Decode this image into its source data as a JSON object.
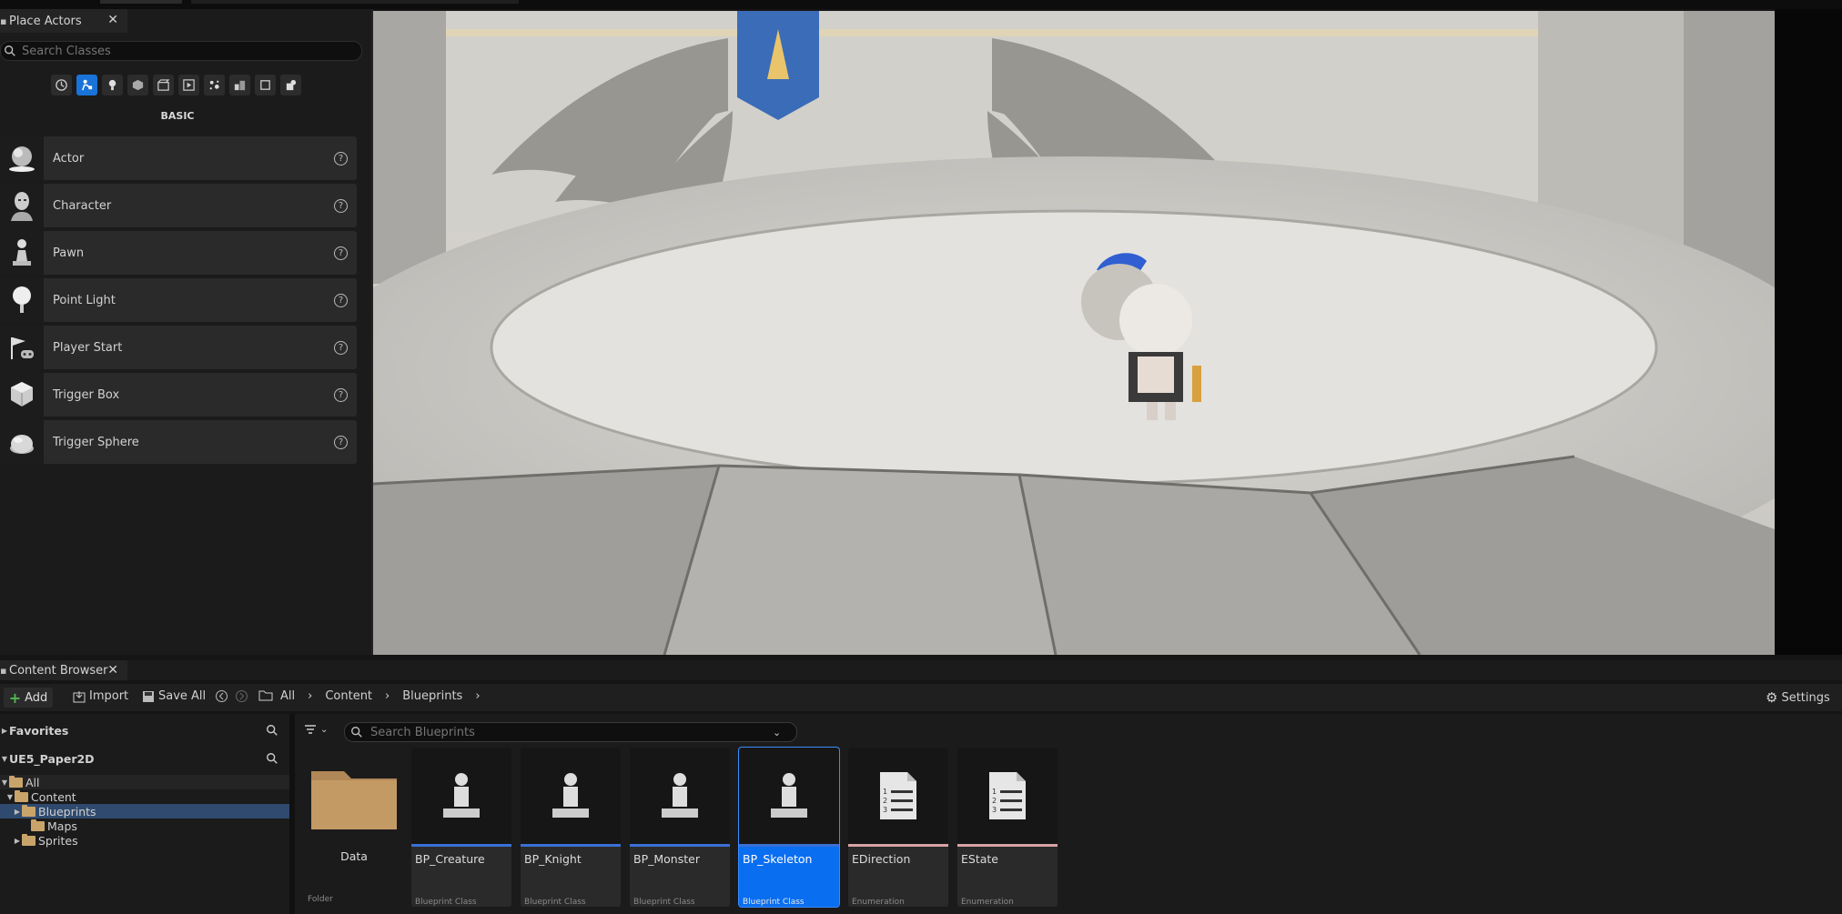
{
  "place_actors": {
    "tab_label": "Place Actors",
    "search_placeholder": "Search Classes",
    "category_icons": [
      "recent-icon",
      "basic-actors-icon",
      "lights-icon",
      "shapes-icon",
      "cinematic-icon",
      "visual-effects-icon",
      "volumes-icon",
      "all-classes-icon",
      "geometry-icon",
      "shapes-extra-icon"
    ],
    "section_label": "BASIC",
    "items": [
      {
        "label": "Actor",
        "icon": "sphere-actor-icon"
      },
      {
        "label": "Character",
        "icon": "character-icon"
      },
      {
        "label": "Pawn",
        "icon": "pawn-icon"
      },
      {
        "label": "Point Light",
        "icon": "point-light-icon"
      },
      {
        "label": "Player Start",
        "icon": "player-start-icon"
      },
      {
        "label": "Trigger Box",
        "icon": "trigger-box-icon"
      },
      {
        "label": "Trigger Sphere",
        "icon": "trigger-sphere-icon"
      }
    ]
  },
  "content_browser": {
    "tab_label": "Content Browser",
    "toolbar": {
      "add_label": "Add",
      "import_label": "Import",
      "save_all_label": "Save All",
      "breadcrumb": [
        "All",
        "Content",
        "Blueprints"
      ],
      "settings_label": "Settings"
    },
    "sources": {
      "favorites_label": "Favorites",
      "project_label": "UE5_Paper2D",
      "tree": [
        {
          "label": "All",
          "level": 0
        },
        {
          "label": "Content",
          "level": 1
        },
        {
          "label": "Blueprints",
          "level": 2
        },
        {
          "label": "Maps",
          "level": 2
        },
        {
          "label": "Sprites",
          "level": 2
        }
      ]
    },
    "search_placeholder": "Search Blueprints",
    "assets": [
      {
        "name": "Data",
        "type": "Folder"
      },
      {
        "name": "BP_Creature",
        "type": "Blueprint Class"
      },
      {
        "name": "BP_Knight",
        "type": "Blueprint Class"
      },
      {
        "name": "BP_Monster",
        "type": "Blueprint Class"
      },
      {
        "name": "BP_Skeleton",
        "type": "Blueprint Class"
      },
      {
        "name": "EDirection",
        "type": "Enumeration"
      },
      {
        "name": "EState",
        "type": "Enumeration"
      }
    ]
  },
  "colors": {
    "accent": "#0a6ef0",
    "blueprint_stripe": "#3a6fd4",
    "enum_stripe": "#d9a3a3",
    "add_plus": "#4fb84f",
    "folder": "#c9a46a"
  }
}
